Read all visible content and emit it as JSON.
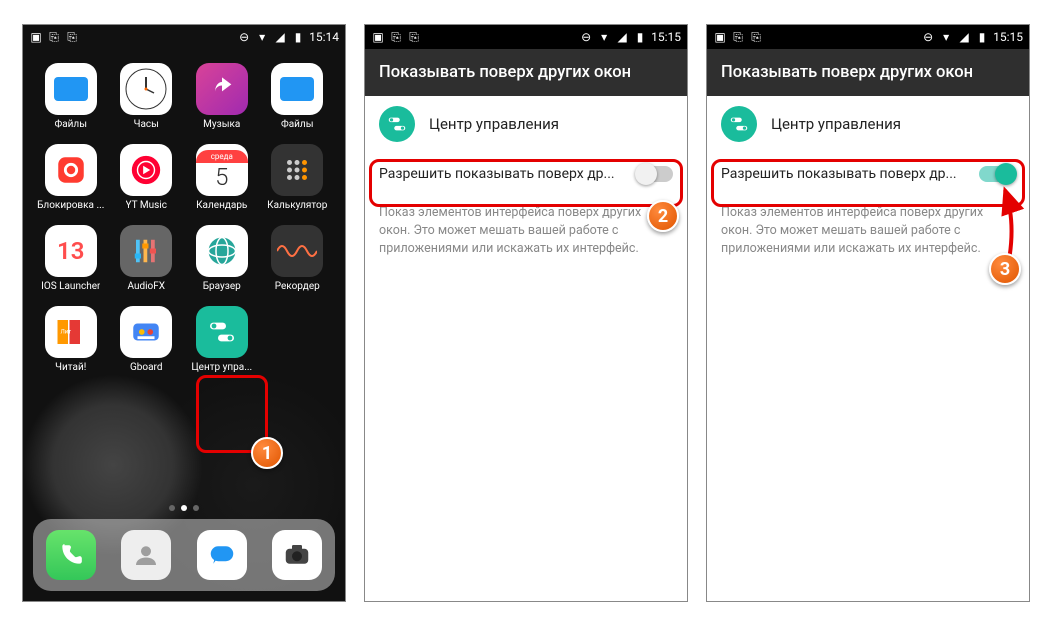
{
  "statusbar": {
    "time_home": "15:14",
    "time_settings": "15:15"
  },
  "home": {
    "apps": [
      {
        "label": "Файлы",
        "icon": "folder"
      },
      {
        "label": "Часы",
        "icon": "clock"
      },
      {
        "label": "Музыка",
        "icon": "music"
      },
      {
        "label": "Файлы",
        "icon": "folder"
      },
      {
        "label": "Блокировка ...",
        "icon": "lock"
      },
      {
        "label": "YT Music",
        "icon": "ytmusic"
      },
      {
        "label": "Календарь",
        "icon": "calendar",
        "cal_top": "среда",
        "cal_num": "5"
      },
      {
        "label": "Калькулятор",
        "icon": "calc"
      },
      {
        "label": "IOS Launcher",
        "icon": "ios13",
        "text": "13"
      },
      {
        "label": "AudioFX",
        "icon": "audiofx"
      },
      {
        "label": "Браузер",
        "icon": "browser"
      },
      {
        "label": "Рекордер",
        "icon": "recorder"
      },
      {
        "label": "Читай!",
        "icon": "read"
      },
      {
        "label": "Gboard",
        "icon": "gboard"
      },
      {
        "label": "Центр упра...",
        "icon": "control-center"
      }
    ],
    "dock": [
      "phone",
      "contacts",
      "messages",
      "camera"
    ]
  },
  "settings": {
    "header": "Показывать поверх других окон",
    "app_name": "Центр управления",
    "permission_label": "Разрешить показывать поверх др...",
    "description": "Показ элементов интерфейса поверх других окон. Это может мешать вашей работе с приложениями или искажать их интерфейс."
  },
  "badges": {
    "b1": "1",
    "b2": "2",
    "b3": "3"
  }
}
